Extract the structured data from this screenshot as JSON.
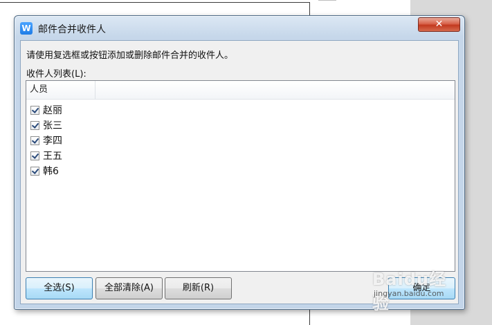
{
  "dialog": {
    "title": "邮件合并收件人",
    "app_icon_letter": "W",
    "close_label": "✕",
    "instruction": "请使用复选框或按钮添加或删除邮件合并的收件人。",
    "list_label": "收件人列表(L):"
  },
  "listview": {
    "column_header": "人员",
    "rows": [
      {
        "label": "赵丽",
        "checked": true
      },
      {
        "label": "张三",
        "checked": true
      },
      {
        "label": "李四",
        "checked": true
      },
      {
        "label": "王五",
        "checked": true
      },
      {
        "label": "韩6",
        "checked": true
      }
    ]
  },
  "buttons": {
    "select_all": "全选(S)",
    "clear_all": "全部清除(A)",
    "refresh": "刷新(R)",
    "ok": "确定"
  },
  "watermark": {
    "text": "Baidu经验",
    "url": "jingyan.baidu.com"
  }
}
